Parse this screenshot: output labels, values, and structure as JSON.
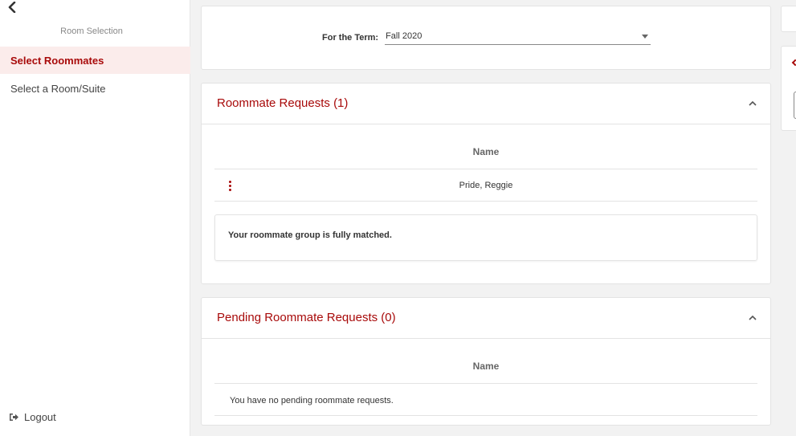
{
  "sidebar": {
    "heading": "Room Selection",
    "items": [
      {
        "label": "Select Roommates",
        "active": true
      },
      {
        "label": "Select a Room/Suite",
        "active": false
      }
    ],
    "logout_label": "Logout"
  },
  "term": {
    "label": "For the Term:",
    "value": "Fall 2020"
  },
  "roommate_requests": {
    "title": "Roommate Requests (1)",
    "column_header": "Name",
    "rows": [
      {
        "name": "Pride, Reggie"
      }
    ],
    "notice": "Your roommate group is fully matched."
  },
  "pending_requests": {
    "title": "Pending Roommate Requests (0)",
    "column_header": "Name",
    "empty_message": "You have no pending roommate requests."
  },
  "colors": {
    "accent": "#a80a0a",
    "active_bg": "#fbeceb",
    "page_bg": "#f2f2f2"
  },
  "icons": [
    "chevron-left-icon",
    "chevron-up-icon",
    "kebab-menu-icon",
    "logout-icon",
    "dropdown-caret-icon"
  ]
}
